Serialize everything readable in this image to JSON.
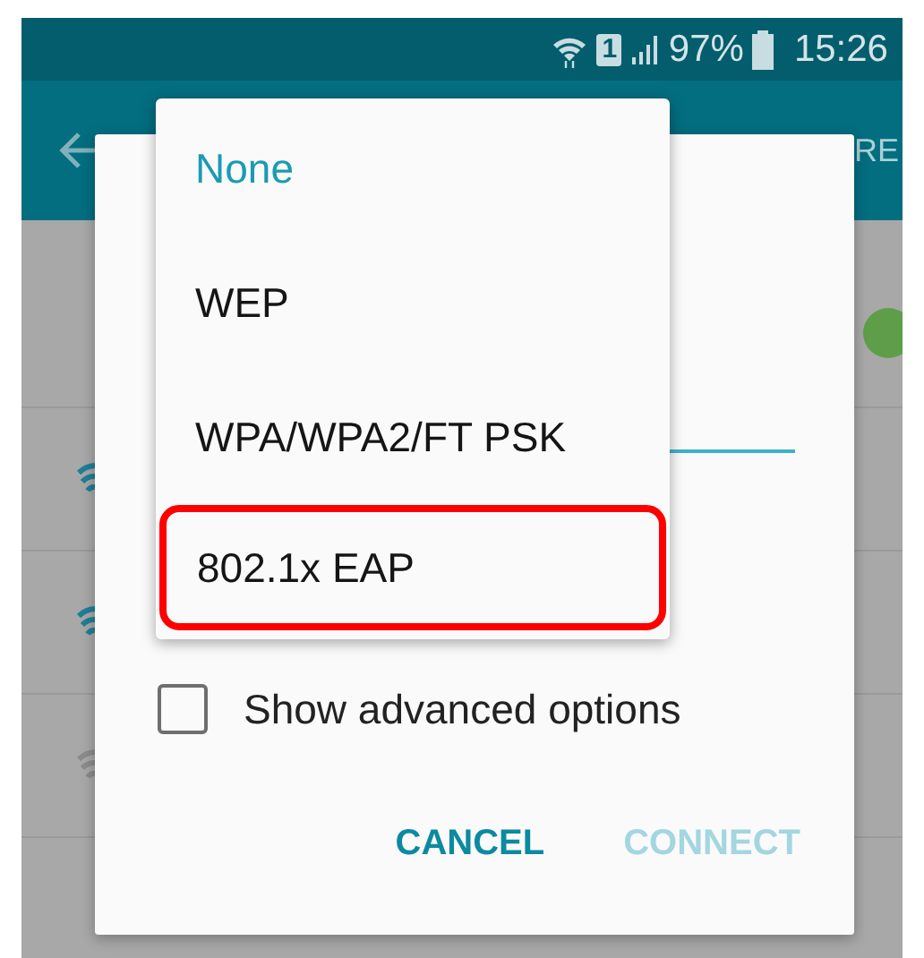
{
  "status_bar": {
    "sim_slot": "1",
    "battery": "97%",
    "time": "15:26"
  },
  "app_bar": {
    "action": "RE"
  },
  "wifi_switch": {
    "on": true
  },
  "networks": [
    {
      "dimmed": false
    },
    {
      "dimmed": false
    },
    {
      "dimmed": true
    }
  ],
  "dialog": {
    "advanced_option": {
      "label": "Show advanced options",
      "checked": false
    },
    "buttons": [
      {
        "label": "CANCEL",
        "disabled": false
      },
      {
        "label": "CONNECT",
        "disabled": true
      }
    ]
  },
  "security_menu": {
    "options": [
      {
        "label": "None",
        "selected": true,
        "highlighted": false
      },
      {
        "label": "WEP",
        "selected": false,
        "highlighted": false
      },
      {
        "label": "WPA/WPA2/FT PSK",
        "selected": false,
        "highlighted": false
      },
      {
        "label": "802.1x EAP",
        "selected": false,
        "highlighted": true
      }
    ]
  }
}
